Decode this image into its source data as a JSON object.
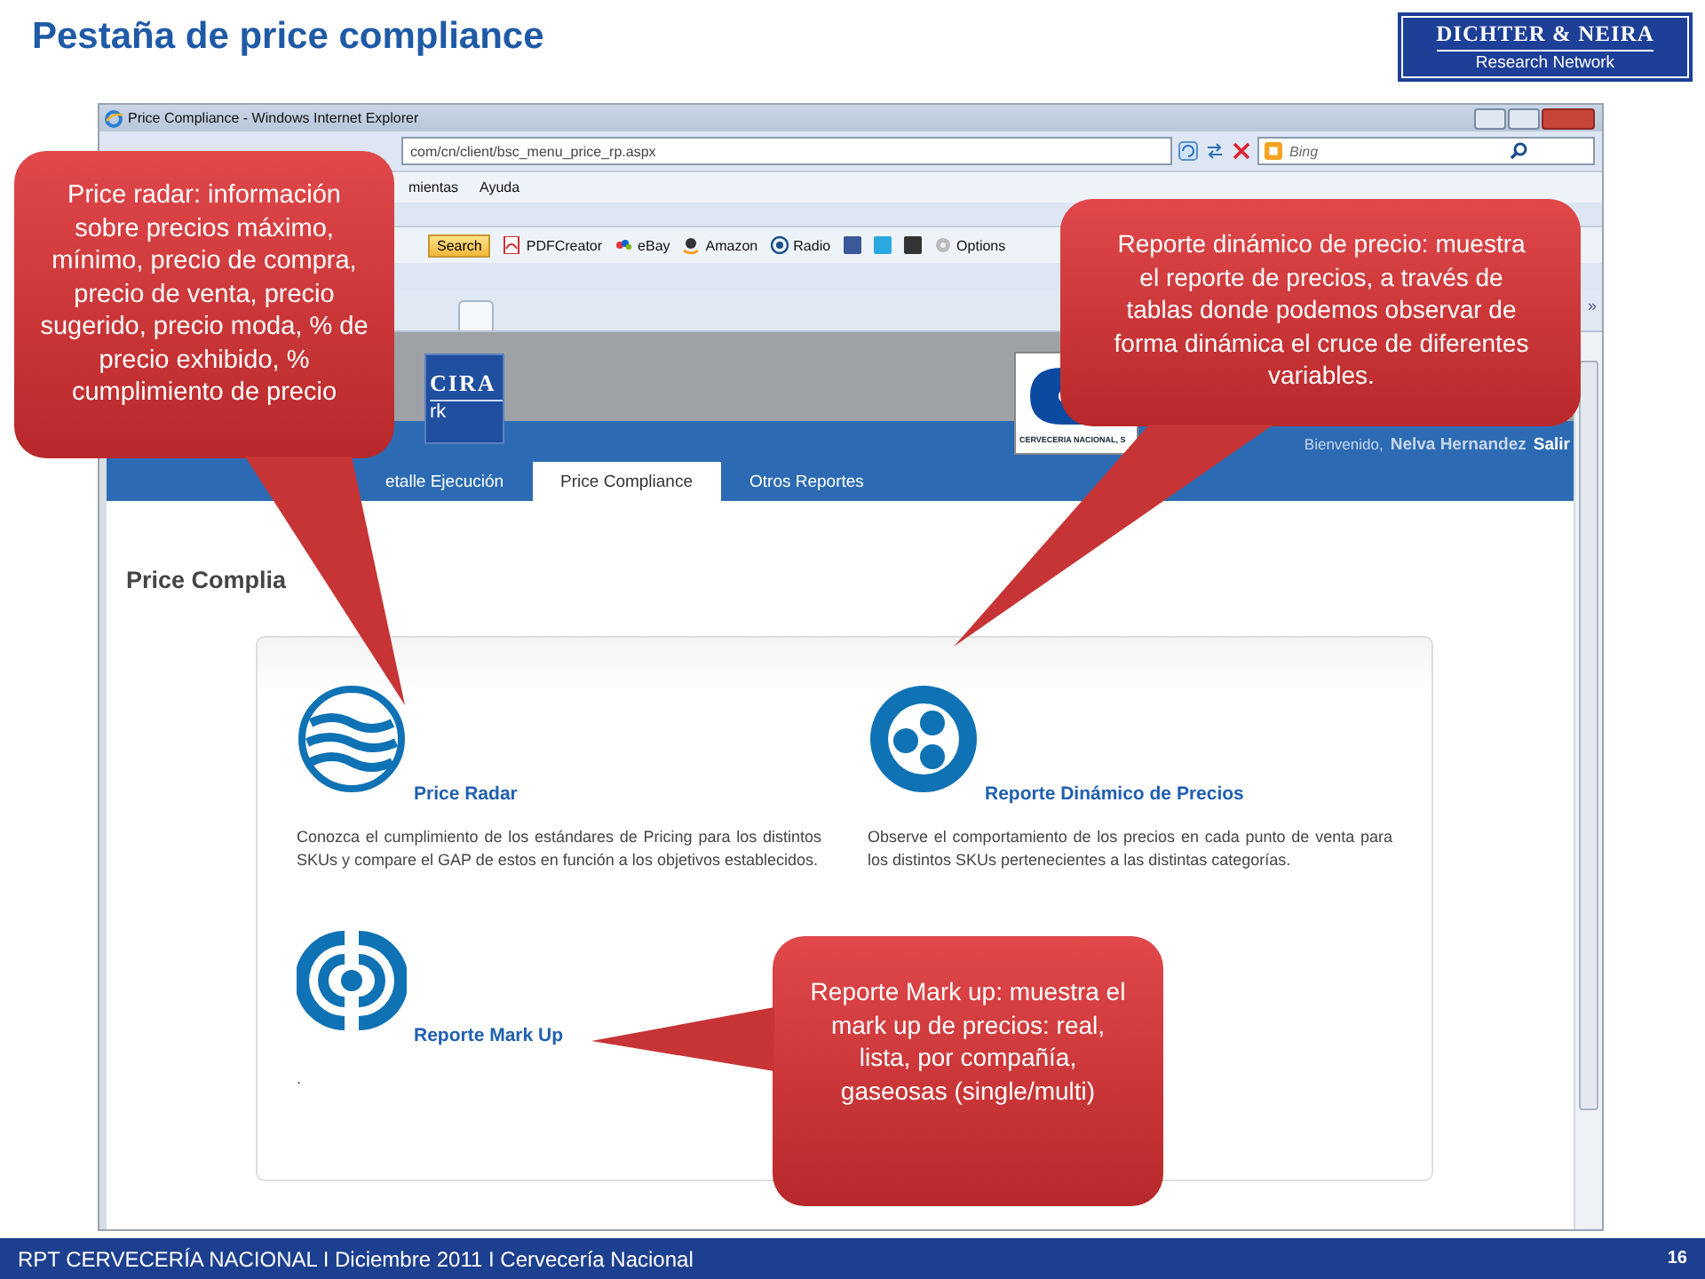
{
  "slide": {
    "title": "Pestaña de price compliance",
    "logo": {
      "line_1": "DICHTER & NEIRA",
      "line_2": "Research Network"
    }
  },
  "browser": {
    "title": "Price Compliance - Windows Internet Explorer",
    "url": "com/cn/client/bsc_menu_price_rp.aspx",
    "search_placeholder": "Bing",
    "menu": [
      "mientas",
      "Ayuda"
    ],
    "toolbar": [
      {
        "kind": "button",
        "label": "Search"
      },
      {
        "kind": "pdf",
        "label": "PDFCreator"
      },
      {
        "kind": "ebay",
        "label": "eBay"
      },
      {
        "kind": "amazon",
        "label": "Amazon"
      },
      {
        "kind": "radio",
        "label": "Radio"
      },
      {
        "kind": "tile",
        "color": "#3b5998"
      },
      {
        "kind": "tile",
        "color": "#2aa9e0"
      },
      {
        "kind": "tile",
        "color": "#333333"
      },
      {
        "kind": "options",
        "label": "Options"
      }
    ],
    "overflow": "»"
  },
  "page": {
    "header": {
      "left_logo": [
        "CIRA",
        "rk"
      ],
      "right_logo": "CERVECERIA NACIONAL, S",
      "welcome": "Bienvenido,",
      "user": "Nelva Hernandez",
      "logout": "Salir"
    },
    "tabs": [
      {
        "label": "etalle Ejecución",
        "selected": false
      },
      {
        "label": "Price Compliance",
        "selected": true
      },
      {
        "label": "Otros Reportes",
        "selected": false
      }
    ],
    "heading": "Price Complia",
    "reports": [
      {
        "kind": "waves",
        "title": "Price Radar",
        "description": "Conozca el cumplimiento de los estándares de Pricing para los distintos SKUs y compare el GAP de estos en función a los objetivos establecidos."
      },
      {
        "kind": "circles",
        "title": "Reporte Dinámico de Precios",
        "description": "Observe el comportamiento de los precios en cada punto de venta para los distintos SKUs pertenecientes a las distintas categorías."
      },
      {
        "kind": "signal",
        "title": "Reporte Mark Up",
        "description": "."
      }
    ]
  },
  "callouts": [
    {
      "text": "Price radar:  información sobre precios máximo, mínimo, precio de compra, precio de venta, precio sugerido, precio moda, % de precio exhibido, % cumplimiento de precio"
    },
    {
      "text": "Reporte dinámico de precio: muestra el reporte de precios, a través de tablas donde podemos observar de forma dinámica el cruce de diferentes variables."
    },
    {
      "text": "Reporte Mark up: muestra el mark up de precios:  real, lista, por compañía, gaseosas (single/multi)"
    }
  ],
  "footer": {
    "text": "RPT CERVECERÍA NACIONAL I Diciembre 2011 I Cervecería Nacional",
    "page": "16"
  }
}
